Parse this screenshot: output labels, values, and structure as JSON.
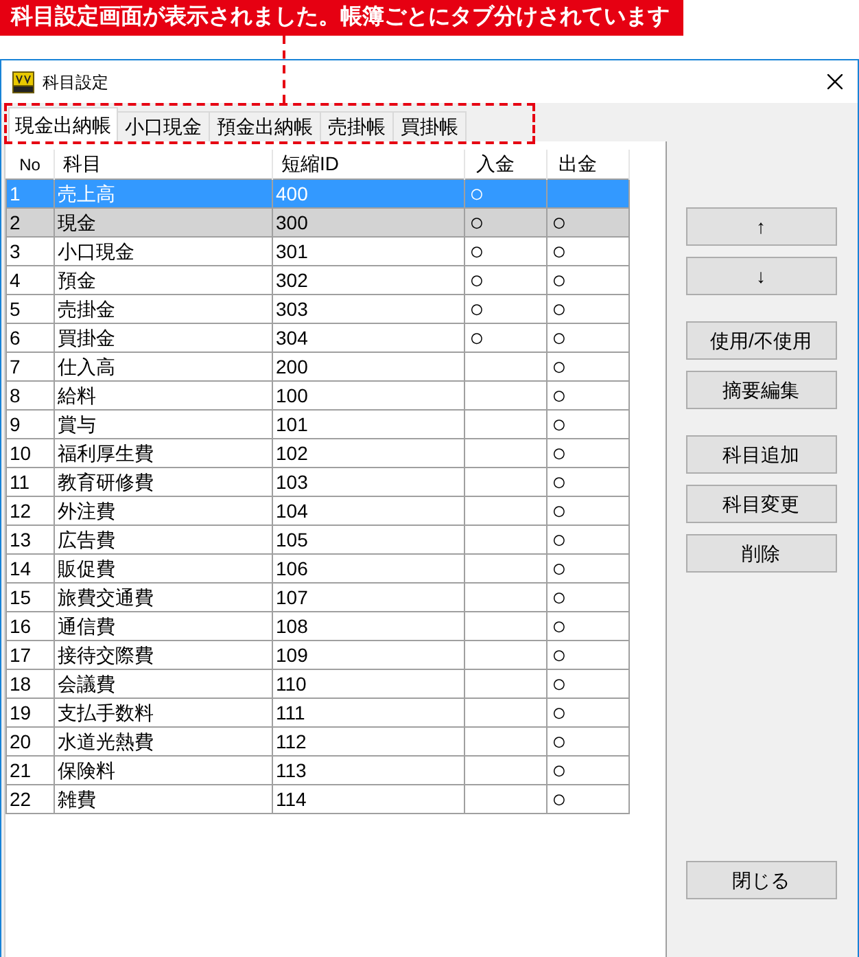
{
  "annotation": {
    "text": "科目設定画面が表示されました。帳簿ごとにタブ分けされています"
  },
  "window": {
    "title": "科目設定"
  },
  "tabs": [
    {
      "label": "現金出納帳",
      "selected": true
    },
    {
      "label": "小口現金",
      "selected": false
    },
    {
      "label": "預金出納帳",
      "selected": false
    },
    {
      "label": "売掛帳",
      "selected": false
    },
    {
      "label": "買掛帳",
      "selected": false
    }
  ],
  "table": {
    "columns": [
      "No",
      "科目",
      "短縮ID",
      "入金",
      "出金"
    ],
    "rows": [
      {
        "no": "1",
        "account": "売上高",
        "short_id": "400",
        "deposit": "○",
        "selected": true,
        "highlighted": false
      },
      {
        "no": "2",
        "account": "現金",
        "short_id": "300",
        "deposit": "○",
        "withdrawal": "○",
        "selected": false,
        "highlighted": true
      },
      {
        "no": "3",
        "account": "小口現金",
        "short_id": "301",
        "deposit": "○",
        "withdrawal": "○",
        "selected": false,
        "highlighted": false
      },
      {
        "no": "4",
        "account": "預金",
        "short_id": "302",
        "deposit": "○",
        "withdrawal": "○",
        "selected": false,
        "highlighted": false
      },
      {
        "no": "5",
        "account": "売掛金",
        "short_id": "303",
        "deposit": "○",
        "withdrawal": "○",
        "selected": false,
        "highlighted": false
      },
      {
        "no": "6",
        "account": "買掛金",
        "short_id": "304",
        "deposit": "○",
        "withdrawal": "○",
        "selected": false,
        "highlighted": false
      },
      {
        "no": "7",
        "account": "仕入高",
        "short_id": "200",
        "withdrawal": "○",
        "selected": false,
        "highlighted": false
      },
      {
        "no": "8",
        "account": "給料",
        "short_id": "100",
        "withdrawal": "○",
        "selected": false,
        "highlighted": false
      },
      {
        "no": "9",
        "account": "賞与",
        "short_id": "101",
        "withdrawal": "○",
        "selected": false,
        "highlighted": false
      },
      {
        "no": "10",
        "account": "福利厚生費",
        "short_id": "102",
        "withdrawal": "○",
        "selected": false,
        "highlighted": false
      },
      {
        "no": "11",
        "account": "教育研修費",
        "short_id": "103",
        "withdrawal": "○",
        "selected": false,
        "highlighted": false
      },
      {
        "no": "12",
        "account": "外注費",
        "short_id": "104",
        "withdrawal": "○",
        "selected": false,
        "highlighted": false
      },
      {
        "no": "13",
        "account": "広告費",
        "short_id": "105",
        "withdrawal": "○",
        "selected": false,
        "highlighted": false
      },
      {
        "no": "14",
        "account": "販促費",
        "short_id": "106",
        "withdrawal": "○",
        "selected": false,
        "highlighted": false
      },
      {
        "no": "15",
        "account": "旅費交通費",
        "short_id": "107",
        "withdrawal": "○",
        "selected": false,
        "highlighted": false
      },
      {
        "no": "16",
        "account": "通信費",
        "short_id": "108",
        "withdrawal": "○",
        "selected": false,
        "highlighted": false
      },
      {
        "no": "17",
        "account": "接待交際費",
        "short_id": "109",
        "withdrawal": "○",
        "selected": false,
        "highlighted": false
      },
      {
        "no": "18",
        "account": "会議費",
        "short_id": "110",
        "withdrawal": "○",
        "selected": false,
        "highlighted": false
      },
      {
        "no": "19",
        "account": "支払手数料",
        "short_id": "111",
        "withdrawal": "○",
        "selected": false,
        "highlighted": false
      },
      {
        "no": "20",
        "account": "水道光熱費",
        "short_id": "112",
        "withdrawal": "○",
        "selected": false,
        "highlighted": false
      },
      {
        "no": "21",
        "account": "保険料",
        "short_id": "113",
        "withdrawal": "○",
        "selected": false,
        "highlighted": false
      },
      {
        "no": "22",
        "account": "雑費",
        "short_id": "114",
        "withdrawal": "○",
        "selected": false,
        "highlighted": false
      }
    ]
  },
  "button_groups": [
    [
      "↑",
      "↓"
    ],
    [
      "使用/不使用",
      "摘要編集"
    ],
    [
      "科目追加",
      "科目変更",
      "削除"
    ]
  ],
  "close_button": "閉じる"
}
